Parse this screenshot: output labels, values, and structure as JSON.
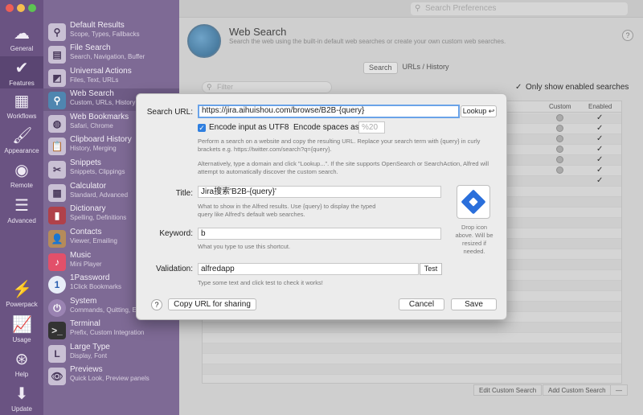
{
  "colors": {
    "nav_bg": "#6a5382",
    "category_bg": "#7e6a95",
    "accent": "#2f7fe0"
  },
  "window": {
    "search_placeholder": "Search Preferences"
  },
  "nav": [
    {
      "label": "General",
      "icon": "cloud-icon"
    },
    {
      "label": "Features",
      "icon": "checkmark-icon"
    },
    {
      "label": "Workflows",
      "icon": "grid-icon"
    },
    {
      "label": "Appearance",
      "icon": "paint-roller-icon"
    },
    {
      "label": "Remote",
      "icon": "remote-icon"
    },
    {
      "label": "Advanced",
      "icon": "sliders-icon"
    },
    {
      "label": "Powerpack",
      "icon": "battery-icon"
    },
    {
      "label": "Usage",
      "icon": "chart-icon"
    },
    {
      "label": "Help",
      "icon": "lifebuoy-icon"
    },
    {
      "label": "Update",
      "icon": "download-icon"
    }
  ],
  "categories": [
    {
      "title": "Default Results",
      "sub": "Scope, Types, Fallbacks"
    },
    {
      "title": "File Search",
      "sub": "Search, Navigation, Buffer"
    },
    {
      "title": "Universal Actions",
      "sub": "Files, Text, URLs"
    },
    {
      "title": "Web Search",
      "sub": "Custom, URLs, History"
    },
    {
      "title": "Web Bookmarks",
      "sub": "Safari, Chrome"
    },
    {
      "title": "Clipboard History",
      "sub": "History, Merging"
    },
    {
      "title": "Snippets",
      "sub": "Snippets, Clippings"
    },
    {
      "title": "Calculator",
      "sub": "Standard, Advanced"
    },
    {
      "title": "Dictionary",
      "sub": "Spelling, Definitions"
    },
    {
      "title": "Contacts",
      "sub": "Viewer, Emailing"
    },
    {
      "title": "Music",
      "sub": "Mini Player"
    },
    {
      "title": "1Password",
      "sub": "1Click Bookmarks"
    },
    {
      "title": "System",
      "sub": "Commands, Quitting, E"
    },
    {
      "title": "Terminal",
      "sub": "Prefix, Custom Integration"
    },
    {
      "title": "Large Type",
      "sub": "Display, Font"
    },
    {
      "title": "Previews",
      "sub": "Quick Look, Preview panels"
    }
  ],
  "page": {
    "title": "Web Search",
    "description": "Search the web using the built-in default web searches or create your own custom web searches.",
    "help": "?"
  },
  "tabs": {
    "search": "Search",
    "history": "URLs / History"
  },
  "filter": {
    "placeholder": "Filter"
  },
  "only_enabled": {
    "label": "Only show enabled searches",
    "checked": true
  },
  "table": {
    "col_custom": "Custom",
    "col_enabled": "Enabled"
  },
  "bottom": {
    "edit": "Edit Custom Search",
    "add": "Add Custom Search",
    "remove": "—"
  },
  "dialog": {
    "search_url_label": "Search URL:",
    "search_url_value": "https://jira.aihuishou.com/browse/B2B-{query}",
    "lookup": "Lookup ↩",
    "encode_label": "Encode input as UTF8",
    "encode_spaces_label": "Encode spaces as",
    "encode_spaces_placeholder": "%20",
    "hint1": "Perform a search on a website and copy the resulting URL. Replace your search term with {query} in curly brackets e.g. https://twitter.com/search?q={query}.",
    "hint2": "Alternatively, type a domain and click \"Lookup...\". If the site supports OpenSearch or SearchAction, Alfred will attempt to automatically discover the custom search.",
    "title_label": "Title:",
    "title_value": "Jira搜索'B2B-{query}'",
    "title_hint": "What to show in the Alfred results. Use {query} to display the typed query like Alfred's default web searches.",
    "drop_hint": "Drop icon above. Will be resized if needed.",
    "keyword_label": "Keyword:",
    "keyword_value": "b",
    "keyword_hint": "What you type to use this shortcut.",
    "validation_label": "Validation:",
    "validation_value": "alfredapp",
    "test": "Test",
    "validation_hint": "Type some text and click test to check it works!",
    "help": "?",
    "copy_url": "Copy URL for sharing",
    "cancel": "Cancel",
    "save": "Save"
  }
}
